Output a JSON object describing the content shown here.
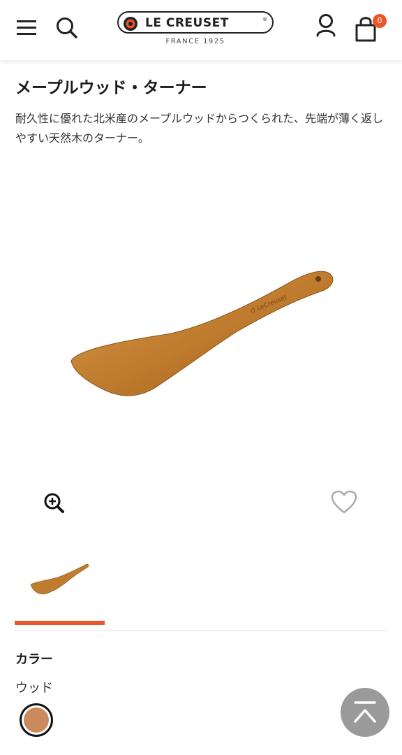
{
  "header": {
    "menu_icon": "hamburger-menu-icon",
    "search_icon": "search-icon",
    "logo": {
      "brand": "LE CREUSET",
      "tagline": "FRANCE 1925"
    },
    "account_icon": "user-icon",
    "cart_icon": "shopping-bag-icon",
    "cart_count": "0"
  },
  "product": {
    "title": "メープルウッド・ターナー",
    "description": "耐久性に優れた北米産のメープルウッドからつくられた、先端が薄く返しやすい天然木のターナー。",
    "zoom_icon": "zoom-in-icon",
    "favorite_icon": "heart-icon"
  },
  "color": {
    "heading": "カラー",
    "selected_value": "ウッド",
    "swatch_color": "#c98a5c"
  },
  "colors": {
    "accent": "#e8562a",
    "wood": "#c07c2e",
    "scroll_top_bg": "#9a9a9a"
  },
  "scroll_top_icon": "scroll-to-top-icon"
}
